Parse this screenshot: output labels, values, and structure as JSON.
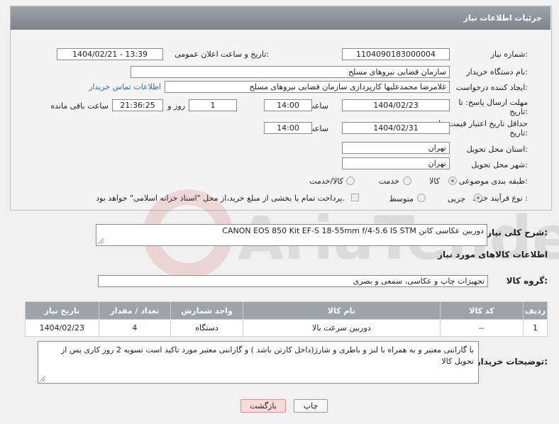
{
  "header": {
    "title": "جزئیات اطلاعات نیاز"
  },
  "form": {
    "need_number_label": "شماره نیاز:",
    "need_number": "1104090183000004",
    "announce_label": "تاریخ و ساعت اعلان عمومی:",
    "announce_value": "1404/02/21 - 13:39",
    "buyer_org_label": "نام دستگاه خریدار:",
    "buyer_org": "سازمان قضایی نیروهای مسلح",
    "requester_label": "ایجاد کننده درخواست:",
    "requester": "غلامرضا  محمدعلیها کارپردازی سازمان قضایی نیروهای مسلح",
    "contact_link": "اطلاعات تماس خریدار",
    "reply_deadline_label": "مهلت ارسال پاسخ: تا تاریخ:",
    "reply_date": "1404/02/23",
    "time_label": "ساعت",
    "reply_time": "14:00",
    "days_value": "1",
    "days_label": "روز و",
    "remaining_time": "21:36:25",
    "remaining_label": "ساعت باقی مانده",
    "price_validity_label": "حداقل تاریخ اعتبار قیمت: تا تاریخ:",
    "price_date": "1404/02/31",
    "price_time": "14:00",
    "province_label": "استان محل تحویل:",
    "province": "تهران",
    "city_label": "شهر محل تحویل:",
    "city": "تهران",
    "category_label": "طبقه بندی موضوعی:",
    "category_options": [
      "کالا",
      "خدمت",
      "کالا/خدمت"
    ],
    "purchase_type_label": "نوع فرآیند خرید :",
    "purchase_options": [
      "جزیی",
      "متوسط"
    ],
    "payment_note": "پرداخت تمام یا بخشی از مبلغ خرید،از محل \"اسناد خزانه اسلامی\" خواهد بود."
  },
  "description": {
    "label": "شرح کلی نیاز:",
    "value": "دوربین  عکاسی کانن CANON EOS  850 Kit EF-S 18-55mm f/4-5.6 IS  STM"
  },
  "goods_section": {
    "title": "اطلاعات کالاهای مورد نیاز",
    "group_label": "گروه کالا:",
    "group_value": "تجهیزات چاپ و عکاسی، سمعی و بصری"
  },
  "table": {
    "headers": [
      "ردیف",
      "کد کالا",
      "نام کالا",
      "واحد شمارش",
      "تعداد / مقدار",
      "تاریخ نیاز"
    ],
    "rows": [
      [
        "1",
        "--",
        "دوربین سرعت بالا",
        "دستگاه",
        "4",
        "1404/02/23"
      ]
    ]
  },
  "buyer_notes": {
    "label": "توضیحات خریدار:",
    "value": "با گارانتی معتبر و به همراه با لنز  و باطری و شارژ(داخل کارتن باشد ) و گارانتی معتبر مورد تاکید است تسویه 2 روز کاری پس از تحویل کالا"
  },
  "buttons": {
    "print": "چاپ",
    "back": "بازگشت"
  },
  "watermark": {
    "text": "AriaTender.net"
  }
}
